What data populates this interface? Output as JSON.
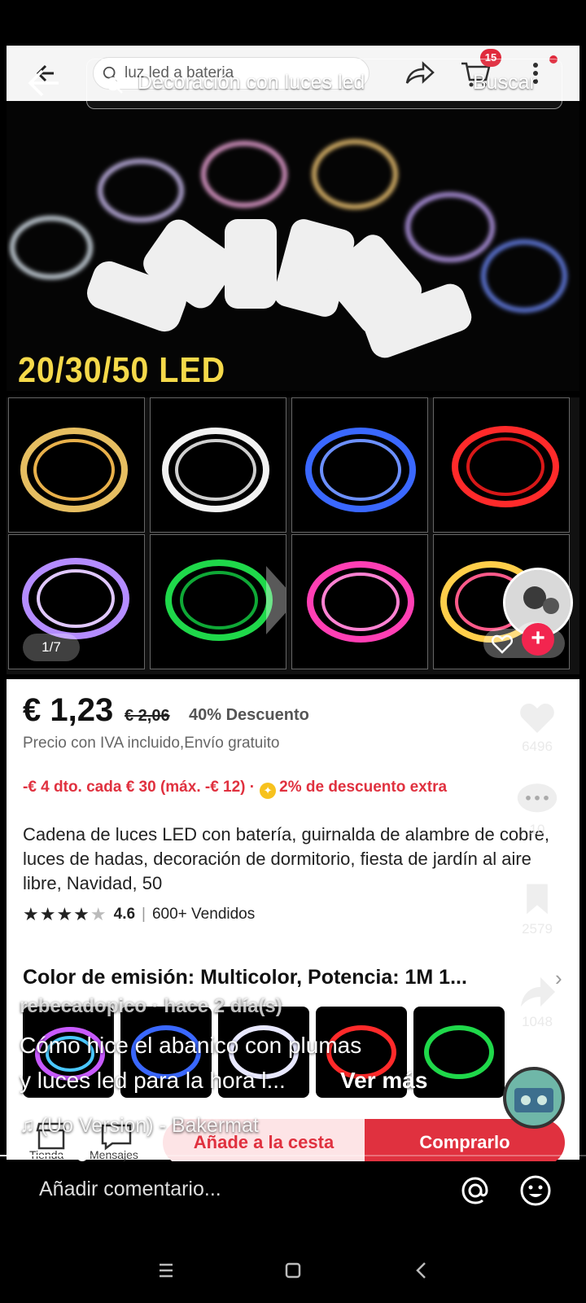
{
  "product_header": {
    "search_placeholder": "luz led a bateria",
    "cart_badge": "15"
  },
  "tiktok_search": {
    "query": "Decoración con luces led",
    "button": "Buscar"
  },
  "hero": {
    "caption": "20/30/50 LED",
    "counter": "1/7"
  },
  "product": {
    "price": "€ 1,23",
    "old_price": "€ 2,06",
    "discount": "40% Descuento",
    "vat_note": "Precio con IVA incluido,Envío gratuito",
    "coupon": "-€ 4  dto. cada € 30 (máx. -€ 12) ·",
    "extra_discount": "2% de descuento extra",
    "title": "Cadena de luces LED con batería, guirnalda de alambre de cobre, luces de hadas, decoración de dormitorio, fiesta de jardín al aire libre, Navidad, 50",
    "rating": "4.6",
    "rating_stars": 4.6,
    "sold": "600+ Vendidos",
    "variant": "Color de emisión: Multicolor, Potencia: 1M 1...",
    "add_to_cart": "Añade a la cesta",
    "buy_now": "Comprarlo",
    "tab_store": "Tienda",
    "tab_messages": "Mensajes"
  },
  "side_actions": {
    "likes": "6496",
    "comments": "10",
    "saves": "2579",
    "shares": "1048"
  },
  "video": {
    "author": "rebecadopico · hace 2 día(s)",
    "description_line1": "Cómo hice el abanico con plumas",
    "description_line2": "y luces led para la hora l...",
    "see_more": "Ver más",
    "music": "♫  (Uo Version) - Bakermat",
    "progress": 0.14
  },
  "comment_bar": {
    "placeholder": "Añadir comentario..."
  },
  "colors": {
    "accent_red": "#e0313f",
    "tiktok_pink": "#f2254f",
    "caption_yellow": "#f5d94a"
  }
}
